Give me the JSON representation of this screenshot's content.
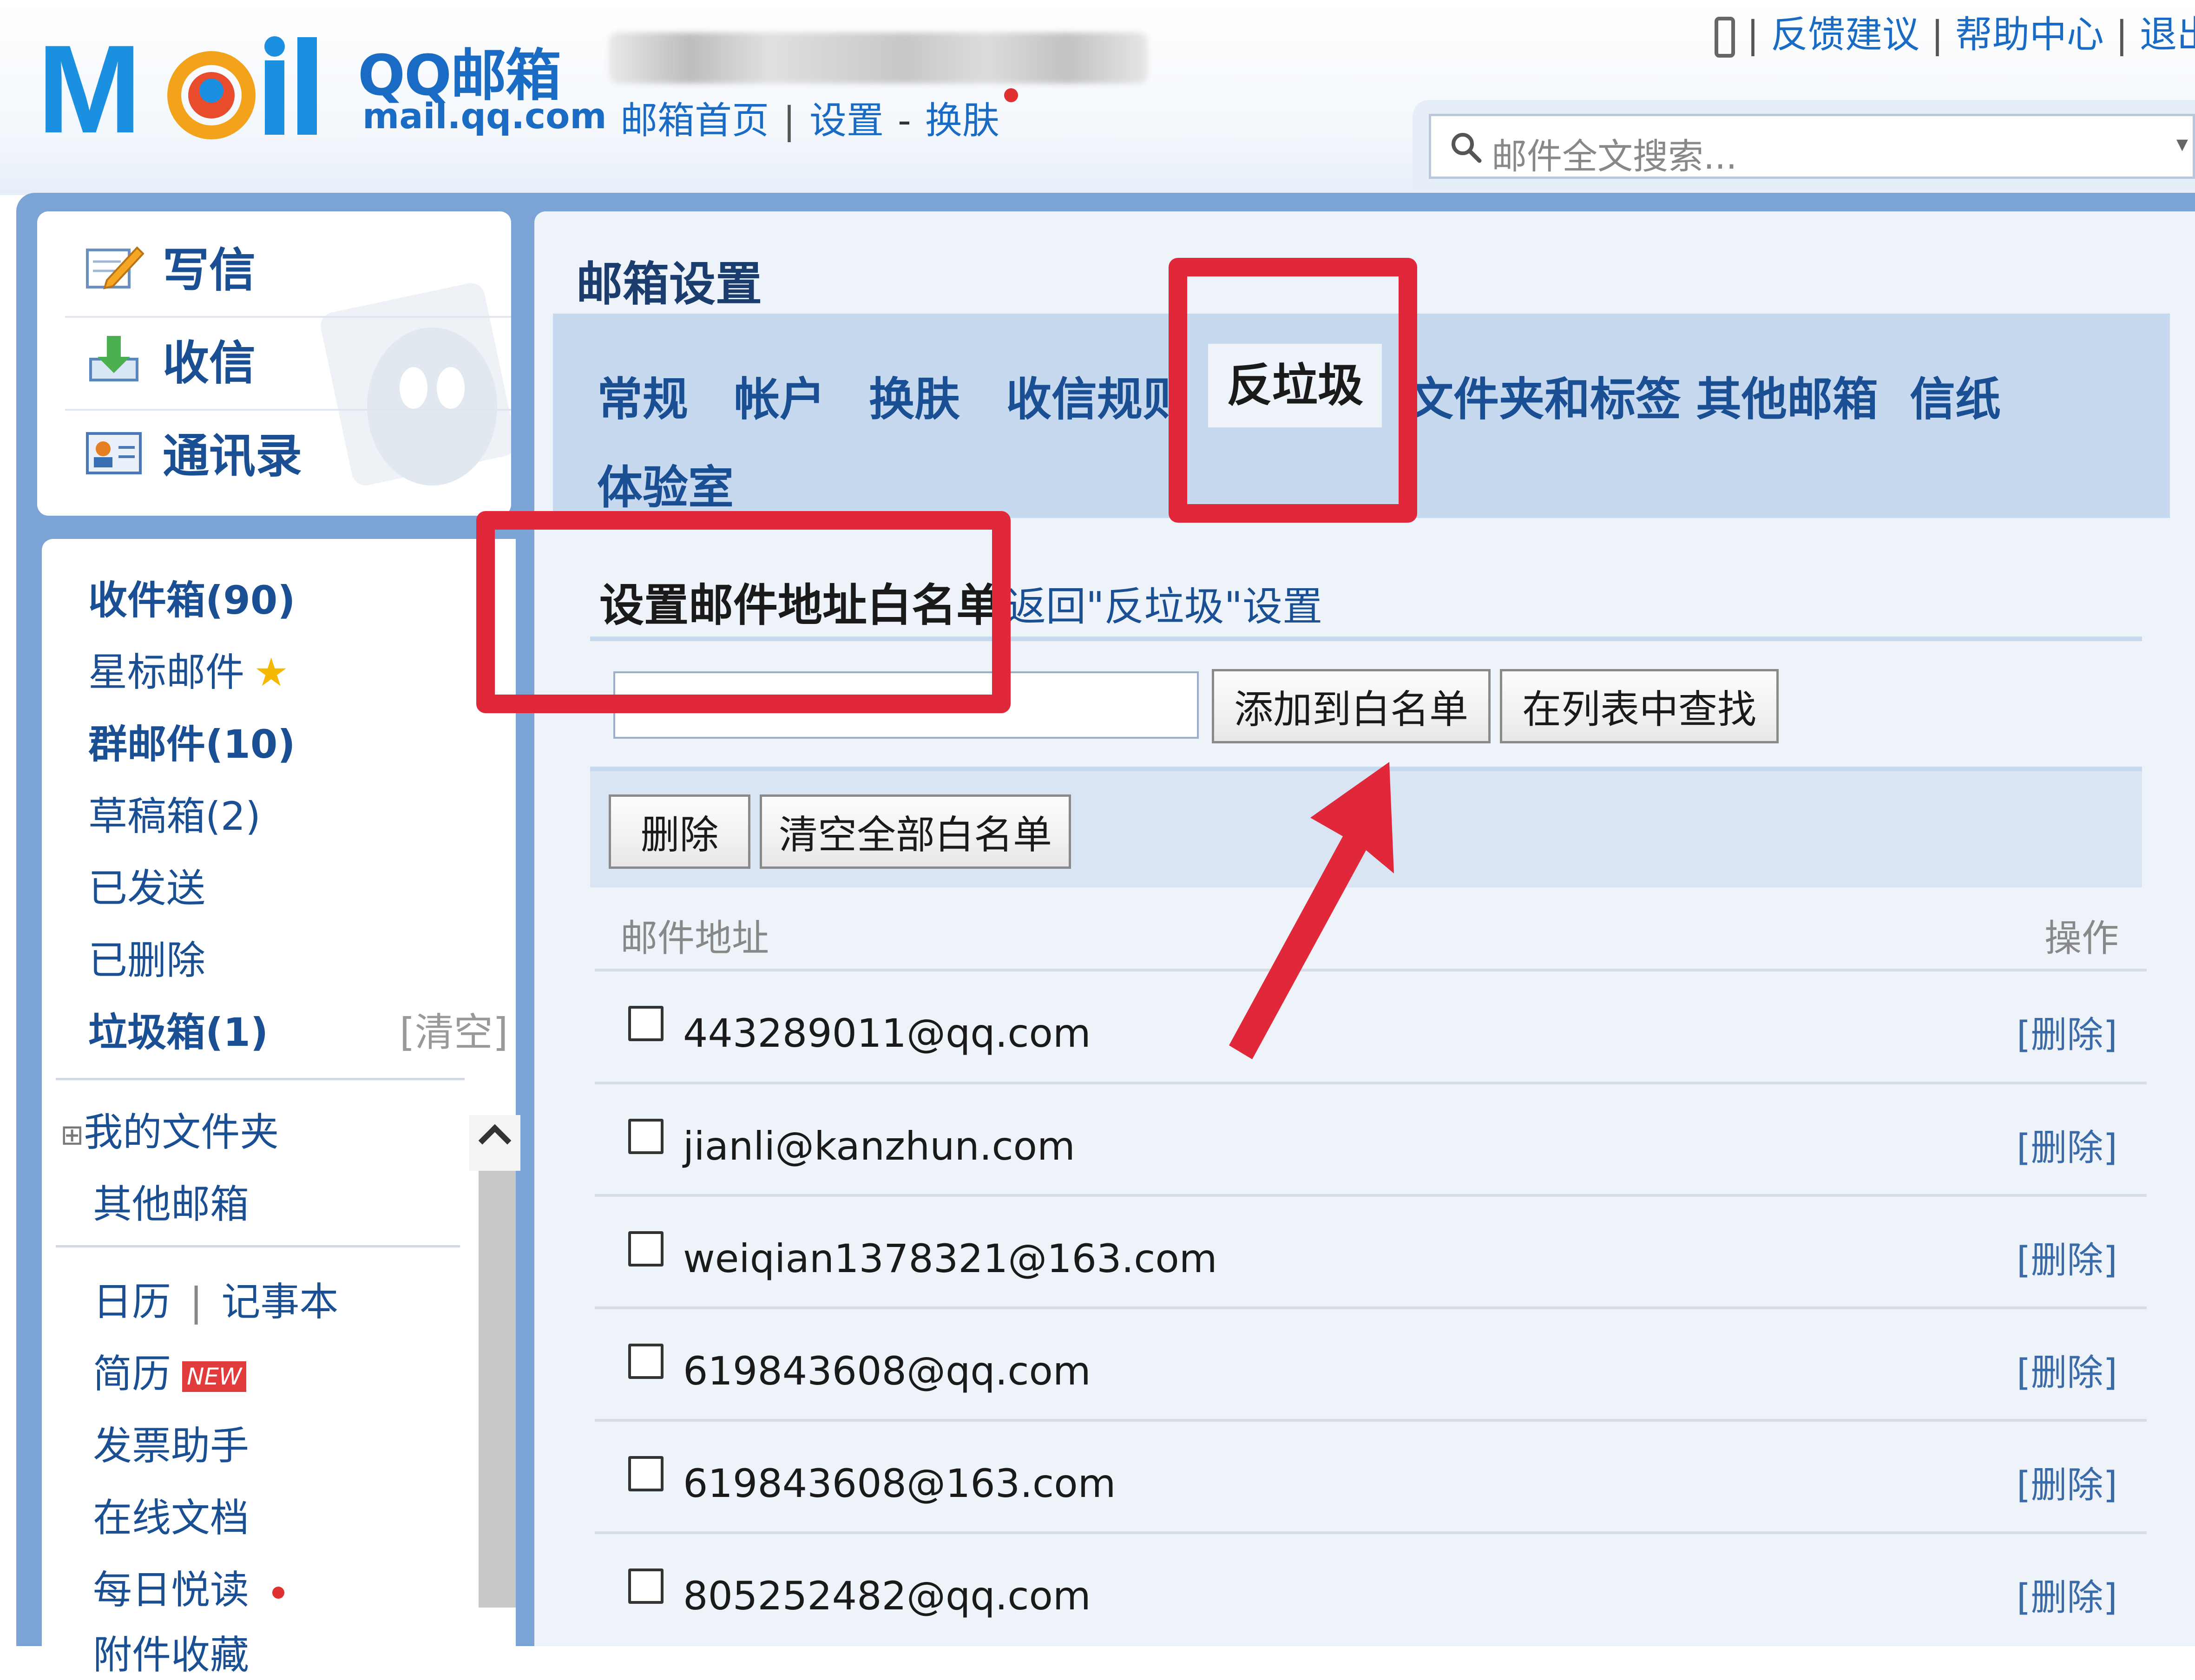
{
  "header": {
    "logo_cn": "QQ邮箱",
    "logo_en": "mail.qq.com",
    "nav": {
      "home": "邮箱首页",
      "sep": "|",
      "settings": "设置",
      "dash": "-",
      "skin": "换肤"
    },
    "links": {
      "feedback": "反馈建议",
      "help": "帮助中心",
      "logout": "退出",
      "sep": "|"
    },
    "search_placeholder": "邮件全文搜索..."
  },
  "left_menu": {
    "compose": "写信",
    "receive": "收信",
    "contacts": "通讯录"
  },
  "folders": {
    "inbox": "收件箱(90)",
    "starred": "星标邮件",
    "group": "群邮件(10)",
    "drafts": "草稿箱(2)",
    "sent": "已发送",
    "deleted": "已删除",
    "spam": "垃圾箱(1)",
    "spam_clear": "[清空]",
    "my_folders": "我的文件夹",
    "other_mailboxes": "其他邮箱",
    "calendar": "日历",
    "notes": "记事本",
    "resume": "简历",
    "new_badge": "NEW",
    "invoice": "发票助手",
    "docs": "在线文档",
    "daily": "每日悦读",
    "attachments": "附件收藏"
  },
  "content": {
    "title": "邮箱设置",
    "tabs": [
      "常规",
      "帐户",
      "换肤",
      "收信规则",
      "反垃圾",
      "文件夹和标签",
      "其他邮箱",
      "信纸",
      "体验室"
    ],
    "active_tab": "反垃圾",
    "sub_title": "设置邮件地址白名单",
    "back_link": "返回\"反垃圾\"设置",
    "add_button": "添加到白名单",
    "find_button": "在列表中查找",
    "delete_button": "删除",
    "clear_button": "清空全部白名单",
    "col_address": "邮件地址",
    "col_action": "操作",
    "rows": [
      {
        "email": "443289011@qq.com",
        "action": "[删除]"
      },
      {
        "email": "jianli@kanzhun.com",
        "action": "[删除]"
      },
      {
        "email": "weiqian1378321@163.com",
        "action": "[删除]"
      },
      {
        "email": "619843608@qq.com",
        "action": "[删除]"
      },
      {
        "email": "619843608@163.com",
        "action": "[删除]"
      },
      {
        "email": "805252482@qq.com",
        "action": "[删除]"
      }
    ]
  },
  "colors": {
    "brand": "#1a6bc4",
    "annotation": "#e0283a",
    "tab_bar": "#c6d9ef",
    "frame": "#7ba3d6"
  }
}
